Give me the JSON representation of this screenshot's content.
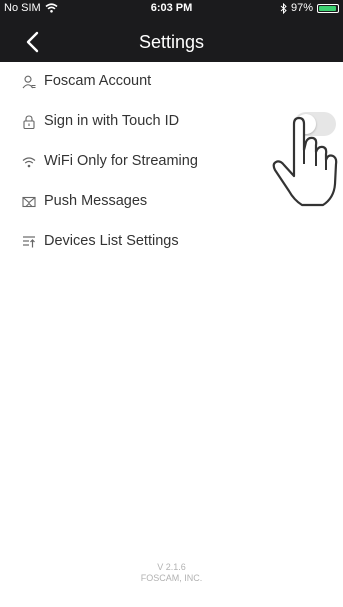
{
  "status_bar": {
    "carrier": "No SIM",
    "time": "6:03 PM",
    "battery": "97%",
    "battery_level": 0.97
  },
  "nav": {
    "title": "Settings"
  },
  "menu": {
    "items": [
      {
        "label": "Foscam Account",
        "icon": "user-icon"
      },
      {
        "label": "Sign in with Touch ID",
        "icon": "lock-icon",
        "toggle_on": false
      },
      {
        "label": "WiFi Only for Streaming",
        "icon": "wifi-icon"
      },
      {
        "label": "Push Messages",
        "icon": "message-icon"
      },
      {
        "label": "Devices List Settings",
        "icon": "list-settings-icon"
      }
    ]
  },
  "footer": {
    "version": "V 2.1.6",
    "company": "FOSCAM, INC."
  },
  "colors": {
    "header_bg": "#1b1b1d",
    "toggle_off": "#e6e6e6",
    "battery_green": "#3cd070"
  }
}
